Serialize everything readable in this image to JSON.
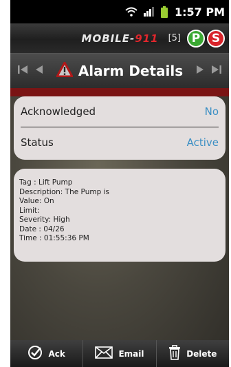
{
  "status_bar": {
    "time": "1:57 PM",
    "icons": [
      "wifi-icon",
      "signal-icon",
      "battery-icon"
    ]
  },
  "brand": {
    "logo_part1": "MOBILE-",
    "logo_part2": "911",
    "count": "[5]",
    "badge_p": "P",
    "badge_s": "S"
  },
  "nav": {
    "title": "Alarm Details",
    "icons": [
      "first-icon",
      "prev-icon",
      "warning-icon",
      "next-icon",
      "last-icon"
    ]
  },
  "details": {
    "rows": [
      {
        "label": "Acknowledged",
        "value": "No"
      },
      {
        "label": "Status",
        "value": "Active"
      }
    ]
  },
  "info": {
    "lines": [
      "Tag  : Lift Pump",
      "Description: The Pump is",
      "Value: On",
      "Limit:",
      "Severity: High",
      "Date : 04/26",
      "Time : 01:55:36 PM"
    ]
  },
  "actions": {
    "ack": "Ack",
    "email": "Email",
    "delete": "Delete"
  },
  "colors": {
    "accent_blue": "#3b8fc4",
    "badge_green": "#3aa832",
    "badge_red": "#d8232a"
  }
}
